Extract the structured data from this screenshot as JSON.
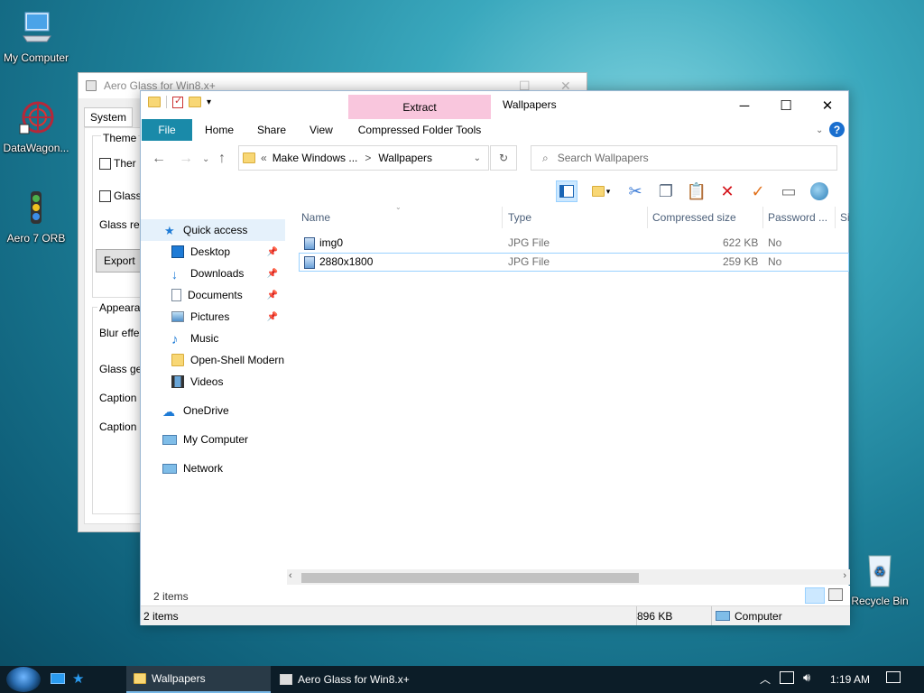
{
  "desktop": {
    "icons": [
      {
        "label": "My Computer",
        "icon": "computer-icon"
      },
      {
        "label": "DataWagon...",
        "icon": "datawagon-icon"
      },
      {
        "label": "Aero 7 ORB",
        "icon": "aero-orb-icon"
      },
      {
        "label": "Recycle Bin",
        "icon": "recycle-bin-icon"
      }
    ]
  },
  "aero_window": {
    "title": "Aero Glass for Win8.x+",
    "tab_system": "System",
    "theme_group": "Theme",
    "check1": "Ther",
    "check2": "Glass",
    "glass_re": "Glass re",
    "export_btn": "Export",
    "appearance_group": "Appeara",
    "blur": "Blur effe",
    "glass_ge": "Glass ge",
    "caption1": "Caption",
    "caption2": "Caption"
  },
  "explorer": {
    "title": "Wallpapers",
    "context_tab": "Extract",
    "context_tools": "Compressed Folder Tools",
    "tabs": {
      "file": "File",
      "home": "Home",
      "share": "Share",
      "view": "View"
    },
    "address": {
      "prefix": "«",
      "segment1": "Make Windows ...",
      "sep": ">",
      "segment2": "Wallpapers"
    },
    "search_placeholder": "Search Wallpapers",
    "nav": {
      "quick_access": "Quick access",
      "desktop": "Desktop",
      "downloads": "Downloads",
      "documents": "Documents",
      "pictures": "Pictures",
      "music": "Music",
      "open_shell": "Open-Shell Modern",
      "videos": "Videos",
      "onedrive": "OneDrive",
      "my_computer": "My Computer",
      "network": "Network"
    },
    "columns": {
      "name": "Name",
      "type": "Type",
      "compressed_size": "Compressed size",
      "password": "Password ...",
      "size": "Si"
    },
    "files": [
      {
        "name": "img0",
        "type": "JPG File",
        "compressed_size": "622 KB",
        "password": "No"
      },
      {
        "name": "2880x1800",
        "type": "JPG File",
        "compressed_size": "259 KB",
        "password": "No"
      }
    ],
    "status_items": "2 items",
    "status_bar": {
      "items": "2 items",
      "size": "896 KB",
      "location": "Computer"
    }
  },
  "taskbar": {
    "items": [
      {
        "label": "Wallpapers"
      },
      {
        "label": "Aero Glass for Win8.x+"
      }
    ],
    "clock": "1:19 AM"
  },
  "colors": {
    "ribbon_file": "#1a8aa9",
    "context_tab": "#f9c6dd",
    "taskbar": "#0c1d28",
    "selection": "#e5f1fb"
  }
}
